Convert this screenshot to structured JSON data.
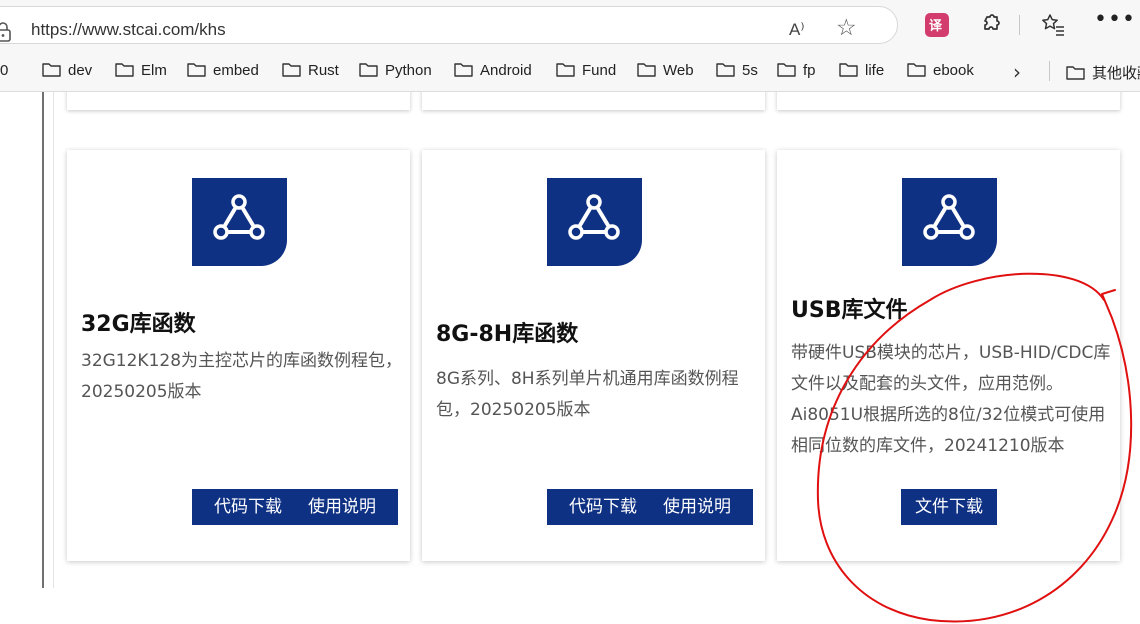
{
  "browser": {
    "url": "https://www.stcai.com/khs",
    "read_aloud_label": "A⁾",
    "more_label": "•••"
  },
  "bookmarks": {
    "items": [
      {
        "label": "0"
      },
      {
        "label": "dev"
      },
      {
        "label": "Elm"
      },
      {
        "label": "embed"
      },
      {
        "label": "Rust"
      },
      {
        "label": "Python"
      },
      {
        "label": "Android"
      },
      {
        "label": "Fund"
      },
      {
        "label": "Web"
      },
      {
        "label": "5s"
      },
      {
        "label": "fp"
      },
      {
        "label": "life"
      },
      {
        "label": "ebook"
      }
    ],
    "other": "其他收藏"
  },
  "cards": [
    {
      "title": "32G库函数",
      "desc": "32G12K128为主控芯片的库函数例程包，20250205版本",
      "buttons": [
        "代码下载",
        "使用说明"
      ]
    },
    {
      "title": "8G-8H库函数",
      "desc": "8G系列、8H系列单片机通用库函数例程包，20250205版本",
      "buttons": [
        "代码下载",
        "使用说明"
      ]
    },
    {
      "title": "USB库文件",
      "desc": "带硬件USB模块的芯片，USB-HID/CDC库文件以及配套的头文件，应用范例。Ai8051U根据所选的8位/32位模式可使用相同位数的库文件，20241210版本",
      "buttons": [
        "文件下载"
      ]
    }
  ],
  "colors": {
    "brand_blue": "#0f3184",
    "annotation_red": "#e01010"
  }
}
